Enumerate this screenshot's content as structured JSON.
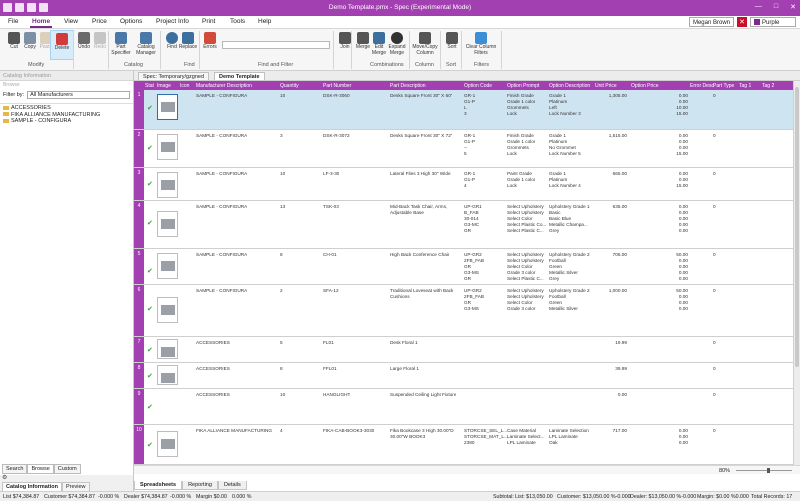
{
  "window": {
    "title": "Demo Template.pmx - Spec (Experimental Mode)",
    "controls": [
      "—",
      "□",
      "✕"
    ]
  },
  "menu": {
    "tabs": [
      "File",
      "Home",
      "View",
      "Price",
      "Options",
      "Project Info",
      "Print",
      "Tools",
      "Help"
    ],
    "active": "Home",
    "user": "Megan Brown",
    "theme": "Purple"
  },
  "ribbon": {
    "buttons": [
      "Cut",
      "Copy",
      "Paste",
      "Delete",
      "Undo",
      "Redo",
      "Part\nSpecifier",
      "Catalog\nManager",
      "Find",
      "Replace",
      "Errors",
      "Join",
      "Merge",
      "Edit\nMerge",
      "Expand\nMerge",
      "Move/Copy\nColumn",
      "Sort",
      "Clear Column\nFilters"
    ],
    "groups": [
      "Modify",
      "Catalog",
      "Find",
      "Find and Filter",
      "Combinations",
      "Column",
      "Sort",
      "Filters"
    ]
  },
  "left": {
    "header": "Catalog Information",
    "sub": "Browse",
    "filter_label": "Filter by:",
    "filter_value": "All Manufacturers",
    "tree": [
      "ACCESSORIES",
      "FIKA ALLIANCE MANUFACTURING",
      "SAMPLE - CONFIGURA"
    ],
    "tabs": [
      "Search",
      "Browse",
      "Custom"
    ],
    "bottom_tabs": [
      "Catalog Information",
      "Preview"
    ]
  },
  "doc_tabs": [
    "Spec: Temporary/gzgned",
    "Demo Template"
  ],
  "grid": {
    "columns": [
      "Stat",
      "Image",
      "Icon",
      "Manufacturer Description",
      "Quantity",
      "Part Number",
      "Part Description",
      "Option Code",
      "Option Prompt",
      "Option Description",
      "Unit Price",
      "Option Price",
      "Error Desc",
      "Part Type",
      "Tag 1",
      "Tag 2"
    ],
    "rows": [
      {
        "n": "1",
        "mfr": "SAMPLE - CONFIGURA",
        "qty": "10",
        "part": "DSK-R-3060",
        "desc": "Desks Square Front 30\" X 60\"",
        "oc": "GR-1\nG1-P\nL\n3",
        "op": "Finish Grade\nGrade 1 color\nGrommets\nLock",
        "od": "Grade 1\nPlatinum\nLeft\nLock Number 3",
        "up": "1,305.00",
        "opr": "0.00\n0.00\n10.00\n15.00",
        "pt": "0"
      },
      {
        "n": "2",
        "mfr": "SAMPLE - CONFIGURA",
        "qty": "3",
        "part": "DSK-R-3072",
        "desc": "Desks Square Front 30\" X 72\"",
        "oc": "GR-1\nG1-P\n--\n5",
        "op": "Finish Grade\nGrade 1 color\nGrommets\nLock",
        "od": "Grade 1\nPlatinum\nNo Grommet\nLock Number 5",
        "up": "1,515.00",
        "opr": "0.00\n0.00\n0.00\n15.00",
        "pt": "0"
      },
      {
        "n": "3",
        "mfr": "SAMPLE - CONFIGURA",
        "qty": "10",
        "part": "LF-3-30",
        "desc": "Lateral Files 3 High 30\" Wide",
        "oc": "GR-1\nG1-P\n4",
        "op": "Paint Grade\nGrade 1 color\nLock",
        "od": "Grade 1\nPlatinum\nLock Number 4",
        "up": "665.00",
        "opr": "0.00\n0.00\n15.00",
        "pt": "0"
      },
      {
        "n": "4",
        "mfr": "SAMPLE - CONFIGURA",
        "qty": "13",
        "part": "TSK-03",
        "desc": "Mid-Back Task Chair, Arms,\nAdjustable Base",
        "oc": "UP-GR1\nB_FAB\n30-014\nG3-MC\nGR",
        "op": "Select Upholstery\nSelect Upholstery\nSelect Color\nSelect Plastic Co...\nSelect Plastic C...",
        "od": "Upholstery Grade 1\nBasic\nBasic Blue\nMetallic Champa...\nGrey",
        "up": "635.00",
        "opr": "0.00\n0.00\n0.00\n0.00\n0.00",
        "pt": "0"
      },
      {
        "n": "5",
        "mfr": "SAMPLE - CONFIGURA",
        "qty": "8",
        "part": "CH-01",
        "desc": "High Back Conference Chair",
        "oc": "UP-GR2\n2FB_FAB\nGR\nG3-MS\nGR",
        "op": "Select Upholstery\nSelect Upholstery\nSelect Color\nGrade 3 color\nSelect Plastic C...",
        "od": "Upholstery Grade 2\nFootball\nGreen\nMetallic Silver\nGrey",
        "up": "705.00",
        "opr": "50.00\n0.00\n0.00\n0.00\n0.00",
        "pt": "0"
      },
      {
        "n": "6",
        "mfr": "SAMPLE - CONFIGURA",
        "qty": "2",
        "part": "SFA-12",
        "desc": "Traditional Loveseat with Back\nCushions",
        "oc": "UP-GR2\n2FB_FAB\nGR\nG3-MS",
        "op": "Select Upholstery\nSelect Upholstery\nSelect Color\nGrade 3 color",
        "od": "Upholstery Grade 2\nFootball\nGreen\nMetallic Silver",
        "up": "1,000.00",
        "opr": "50.00\n0.00\n0.00\n0.00",
        "pt": "0"
      },
      {
        "n": "7",
        "mfr": "ACCESSORIES",
        "qty": "5",
        "part": "FL01",
        "desc": "Desk Floral 1",
        "oc": "",
        "op": "",
        "od": "",
        "up": "19.99",
        "opr": "",
        "pt": "0"
      },
      {
        "n": "8",
        "mfr": "ACCESSORIES",
        "qty": "8",
        "part": "FFL01",
        "desc": "Large Floral 1",
        "oc": "",
        "op": "",
        "od": "",
        "up": "39.99",
        "opr": "",
        "pt": "0"
      },
      {
        "n": "9",
        "mfr": "ACCESSORIES",
        "qty": "10",
        "part": "HANGLIGHT",
        "desc": "Suspended Ceiling Light Fixture",
        "oc": "",
        "op": "",
        "od": "",
        "up": "0.00",
        "opr": "",
        "pt": "0"
      },
      {
        "n": "10",
        "mfr": "FIKA ALLIANCE MANUFACTURING",
        "qty": "4",
        "part": "FIKA-CAB-BOOK3-3030",
        "desc": "Fika Bookcase 3 High 30.00\"D\n30.00\"W BOOK3",
        "oc": "STORCSE_SEL_L...\nSTORCSE_MAT_L...\n2380",
        "op": "Case Material\nLaminate Select...\nLPL Laminate",
        "od": "Laminate Selection\nLPL Laminate\nOak",
        "up": "717.00",
        "opr": "0.00\n0.00\n0.00",
        "pt": "0"
      }
    ]
  },
  "zoom": "80%",
  "bottom_tabs": [
    "Spreadsheets",
    "Reporting",
    "Details"
  ],
  "status": {
    "list": "List $74,384.87",
    "customer": "Customer $74,384.87",
    "pct0": "-0.000 %",
    "dealer": "Dealer $74,384.87",
    "pct1": "-0.000 %",
    "margin": "Margin $0.00",
    "pct2": "0.000 %",
    "subtotal": "Subtotal:",
    "s_list": "List: $13,050.00",
    "s_customer": "Customer: $13,050.00 %-0.000",
    "s_dealer": "Dealer: $13,050.00 %-0.000",
    "s_margin": "Margin: $0.00 %0.000",
    "records": "Total Records: 17"
  }
}
